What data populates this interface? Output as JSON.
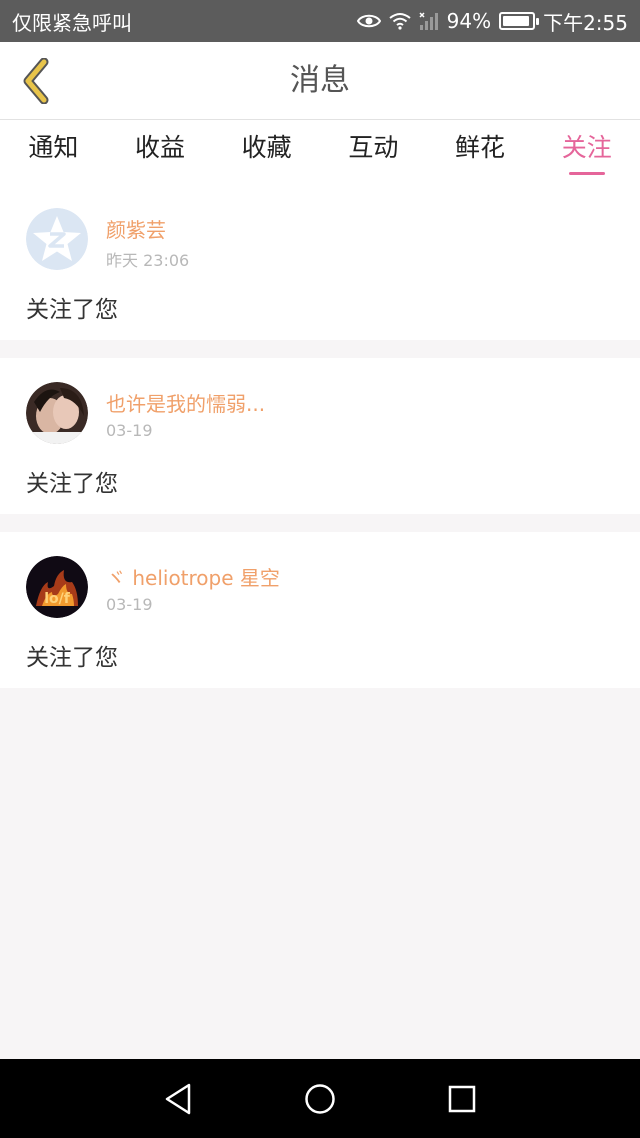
{
  "status_bar": {
    "carrier": "仅限紧急呼叫",
    "battery": "94%",
    "time": "下午2:55"
  },
  "header": {
    "title": "消息",
    "back_icon": "chevron-left-icon"
  },
  "tabs": [
    {
      "label": "通知"
    },
    {
      "label": "收益"
    },
    {
      "label": "收藏"
    },
    {
      "label": "互动"
    },
    {
      "label": "鲜花"
    },
    {
      "label": "关注"
    }
  ],
  "active_tab": "关注",
  "messages": [
    {
      "name": "颜紫芸",
      "time": "昨天 23:06",
      "text": "关注了您"
    },
    {
      "name": "也许是我的懦弱...",
      "time": "03-19",
      "text": "关注了您"
    },
    {
      "name": "ヾ heliotrope 星空",
      "time": "03-19",
      "text": "关注了您"
    }
  ],
  "colors": {
    "accent": "#e5659a",
    "username": "#f0a06a",
    "back_icon": "#e8c44a"
  }
}
